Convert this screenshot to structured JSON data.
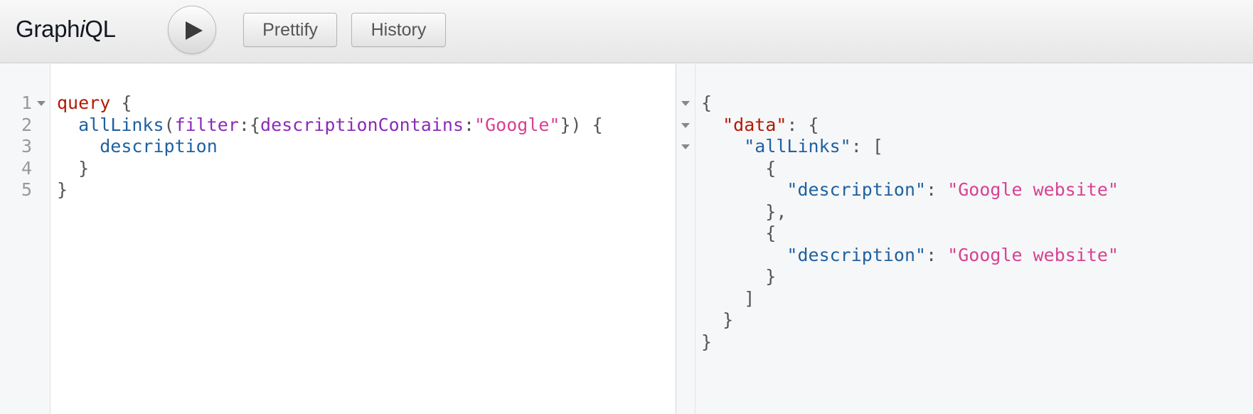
{
  "app": {
    "title_prefix": "Graph",
    "title_italic": "i",
    "title_suffix": "QL"
  },
  "toolbar": {
    "execute_icon": "play-icon",
    "prettify_label": "Prettify",
    "history_label": "History"
  },
  "query_editor": {
    "line_numbers": [
      "1",
      "2",
      "3",
      "4",
      "5"
    ],
    "lines": [
      [
        {
          "t": "query",
          "c": "kw"
        },
        {
          "t": " {",
          "c": "punc"
        }
      ],
      [
        {
          "t": "  ",
          "c": "punc"
        },
        {
          "t": "allLinks",
          "c": "fld"
        },
        {
          "t": "(",
          "c": "punc"
        },
        {
          "t": "filter",
          "c": "arg"
        },
        {
          "t": ":{",
          "c": "punc"
        },
        {
          "t": "descriptionContains",
          "c": "arg"
        },
        {
          "t": ":",
          "c": "punc"
        },
        {
          "t": "\"Google\"",
          "c": "str"
        },
        {
          "t": "}) {",
          "c": "punc"
        }
      ],
      [
        {
          "t": "    ",
          "c": "punc"
        },
        {
          "t": "description",
          "c": "fld"
        }
      ],
      [
        {
          "t": "  }",
          "c": "punc"
        }
      ],
      [
        {
          "t": "}",
          "c": "punc"
        }
      ]
    ]
  },
  "result_viewer": {
    "lines": [
      [
        {
          "t": "{",
          "c": "punc"
        }
      ],
      [
        {
          "t": "  ",
          "c": "punc"
        },
        {
          "t": "\"data\"",
          "c": "keyred"
        },
        {
          "t": ": {",
          "c": "punc"
        }
      ],
      [
        {
          "t": "    ",
          "c": "punc"
        },
        {
          "t": "\"allLinks\"",
          "c": "key"
        },
        {
          "t": ": [",
          "c": "punc"
        }
      ],
      [
        {
          "t": "      {",
          "c": "punc"
        }
      ],
      [
        {
          "t": "        ",
          "c": "punc"
        },
        {
          "t": "\"description\"",
          "c": "key"
        },
        {
          "t": ": ",
          "c": "punc"
        },
        {
          "t": "\"Google website\"",
          "c": "str"
        }
      ],
      [
        {
          "t": "      },",
          "c": "punc"
        }
      ],
      [
        {
          "t": "      {",
          "c": "punc"
        }
      ],
      [
        {
          "t": "        ",
          "c": "punc"
        },
        {
          "t": "\"description\"",
          "c": "key"
        },
        {
          "t": ": ",
          "c": "punc"
        },
        {
          "t": "\"Google website\"",
          "c": "str"
        }
      ],
      [
        {
          "t": "      }",
          "c": "punc"
        }
      ],
      [
        {
          "t": "    ]",
          "c": "punc"
        }
      ],
      [
        {
          "t": "  }",
          "c": "punc"
        }
      ],
      [
        {
          "t": "}",
          "c": "punc"
        }
      ]
    ]
  },
  "colors": {
    "keyword": "#b11a04",
    "field": "#1f61a0",
    "argument": "#8b2bb9",
    "string": "#d64292",
    "punctuation": "#555555"
  }
}
